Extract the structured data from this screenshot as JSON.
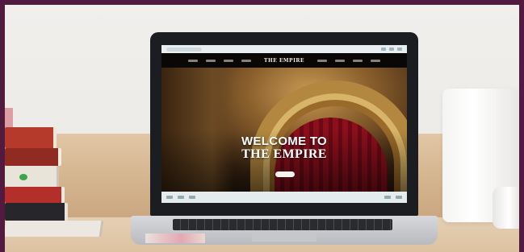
{
  "website": {
    "logo": "THE EMPIRE",
    "hero_line1": "WELCOME TO",
    "hero_line2": "THE EMPIRE"
  }
}
